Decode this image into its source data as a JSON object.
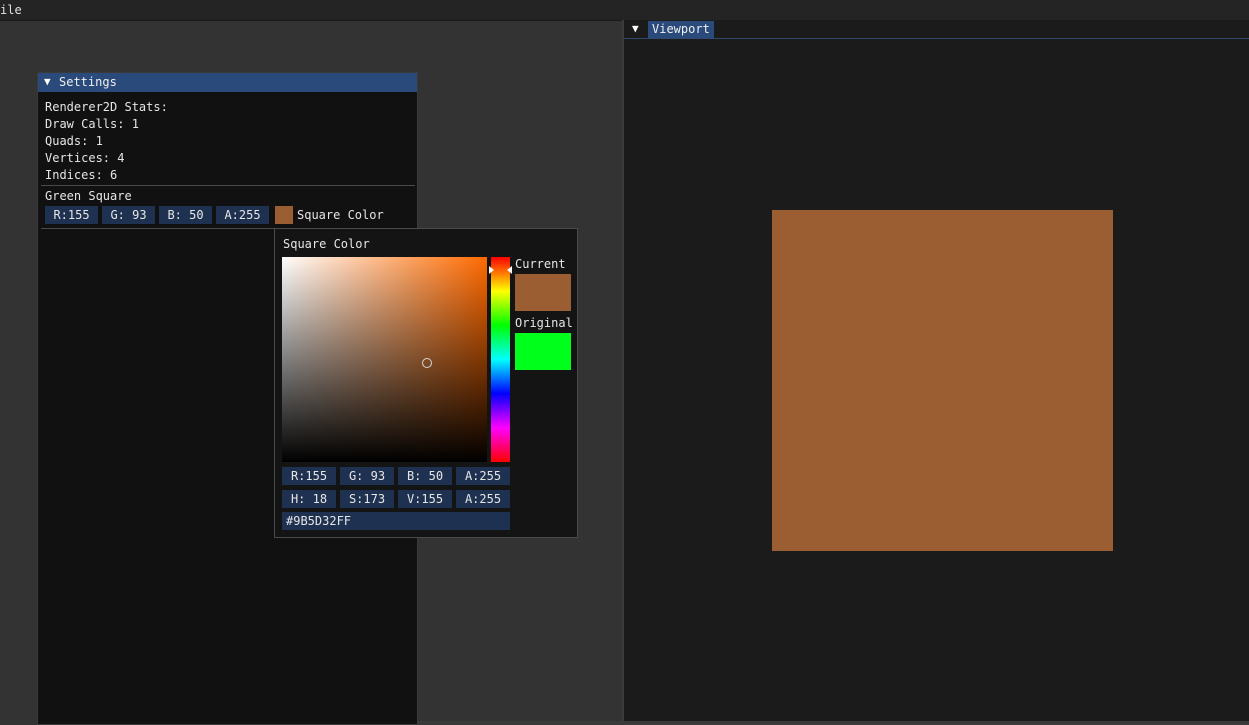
{
  "menubar": {
    "file_label": "ile"
  },
  "settings": {
    "title": "Settings",
    "stats": {
      "header": "Renderer2D Stats:",
      "draw_calls": "Draw Calls: 1",
      "quads": "Quads: 1",
      "vertices": "Vertices: 4",
      "indices": "Indices: 6"
    },
    "entity_name": "Green Square",
    "color_fields": {
      "r": "R:155",
      "g": "G: 93",
      "b": "B: 50",
      "a": "A:255"
    },
    "color_label": "Square Color"
  },
  "picker": {
    "title": "Square Color",
    "current_label": "Current",
    "original_label": "Original",
    "rgba": {
      "r": "R:155",
      "g": "G: 93",
      "b": "B: 50",
      "a": "A:255"
    },
    "hsva": {
      "h": "H: 18",
      "s": "S:173",
      "v": "V:155",
      "a": "A:255"
    },
    "hex": "#9B5D32FF"
  },
  "viewport": {
    "tab_label": "Viewport"
  },
  "colors": {
    "current": "#9b5d32",
    "original": "#00ff1a",
    "accent": "#294a7a",
    "field_bg": "#1f3150"
  }
}
